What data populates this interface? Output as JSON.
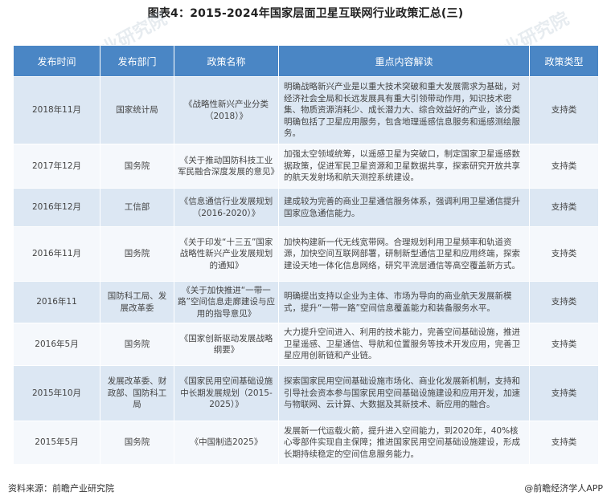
{
  "title": "图表4：2015-2024年国家层面卫星互联网行业政策汇总(三)",
  "table": {
    "headers": [
      "发布时间",
      "发布部门",
      "政策名称",
      "重点内容解读",
      "政策类型"
    ],
    "rows": [
      {
        "date": "2018年11月",
        "department": "国家统计局",
        "policy": "《战略性新兴产业分类（2018）》",
        "content": "明确战略新兴产业是以重大技术突破和重大发展需求为基础，对经济社会全局和长远发展具有重大引领带动作用，知识技术密集、物质资源消耗少、成长潜力大、综合效益好的产业，该分类明确包括了卫星应用服务，包含地理遥感信息服务和遥感测绘服务。",
        "type": "支持类"
      },
      {
        "date": "2017年12月",
        "department": "国务院",
        "policy": "《关于推动国防科技工业军民融合深度发展的意见》",
        "content": "加强太空领域统筹，以遥感卫星为突破口，制定国家卫星遥感数据政策，促进军民卫星资源和卫星数据共享，探索研究开放共享的航天发射场和航天测控系统建设。",
        "type": "支持类"
      },
      {
        "date": "2016年12月",
        "department": "工信部",
        "policy": "《信息通信行业发展规划（2016-2020）》",
        "content": "建成较为完善的商业卫星通信服务体系，强调利用卫星通信提升国家应急通信能力。",
        "type": "支持类"
      },
      {
        "date": "2016年11月",
        "department": "国务院",
        "policy": "《关于印发“十三五”国家战略性新兴产业发展规划的通知》",
        "content": "加快构建新一代无线宽带网。合理规划利用卫星频率和轨道资源，加快空间互联网部署，研制新型通信卫星和应用终端，探索建设天地一体化信息网络，研究平流层通信等高空覆盖新方式。",
        "type": "支持类"
      },
      {
        "date": "2016年11",
        "department": "国防科工局、发展改革委",
        "policy": "《关于加快推进“一带一路”空间信息走廊建设与应用的指导意见》",
        "content": "明确提出支持以企业为主体、市场为导向的商业航天发展新模式，提升“一带一路”空间信息覆盖能力和装备服务水平。",
        "type": "支持类"
      },
      {
        "date": "2016年5月",
        "department": "国务院",
        "policy": "《国家创新驱动发展战略纲要》",
        "content": "大力提升空间进入、利用的技术能力，完善空间基础设施，推进卫星遥感、卫星通信、导航和位置服务等技术开发应用，完善卫星应用创新链和产业链。",
        "type": "支持类"
      },
      {
        "date": "2015年10月",
        "department": "发展改革委、财政部、国防科工局",
        "policy": "《国家民用空间基础设施中长期发展规划（2015-2025）》",
        "content": "探索国家民用空间基础设施市场化、商业化发展新机制，支持和引导社会资本参与国家民用空间基础设施建设和应用开发，加速与物联网、云计算、大数据及其新技术、新应用的融合。",
        "type": "支持类"
      },
      {
        "date": "2015年5月",
        "department": "国务院",
        "policy": "《中国制造2025》",
        "content": "发展新一代运载火箭，提升进入空间能力，到2020年，40%核心零部件实现自主保障；推进国家民用空间基础设施建设，形成长期持续稳定的空间信息服务能力。",
        "type": "支持类"
      }
    ]
  },
  "watermark": "前瞻产业研究院",
  "footer": {
    "source": "资料来源：前瞻产业研究院",
    "credit": "@前瞻经济学人APP"
  }
}
